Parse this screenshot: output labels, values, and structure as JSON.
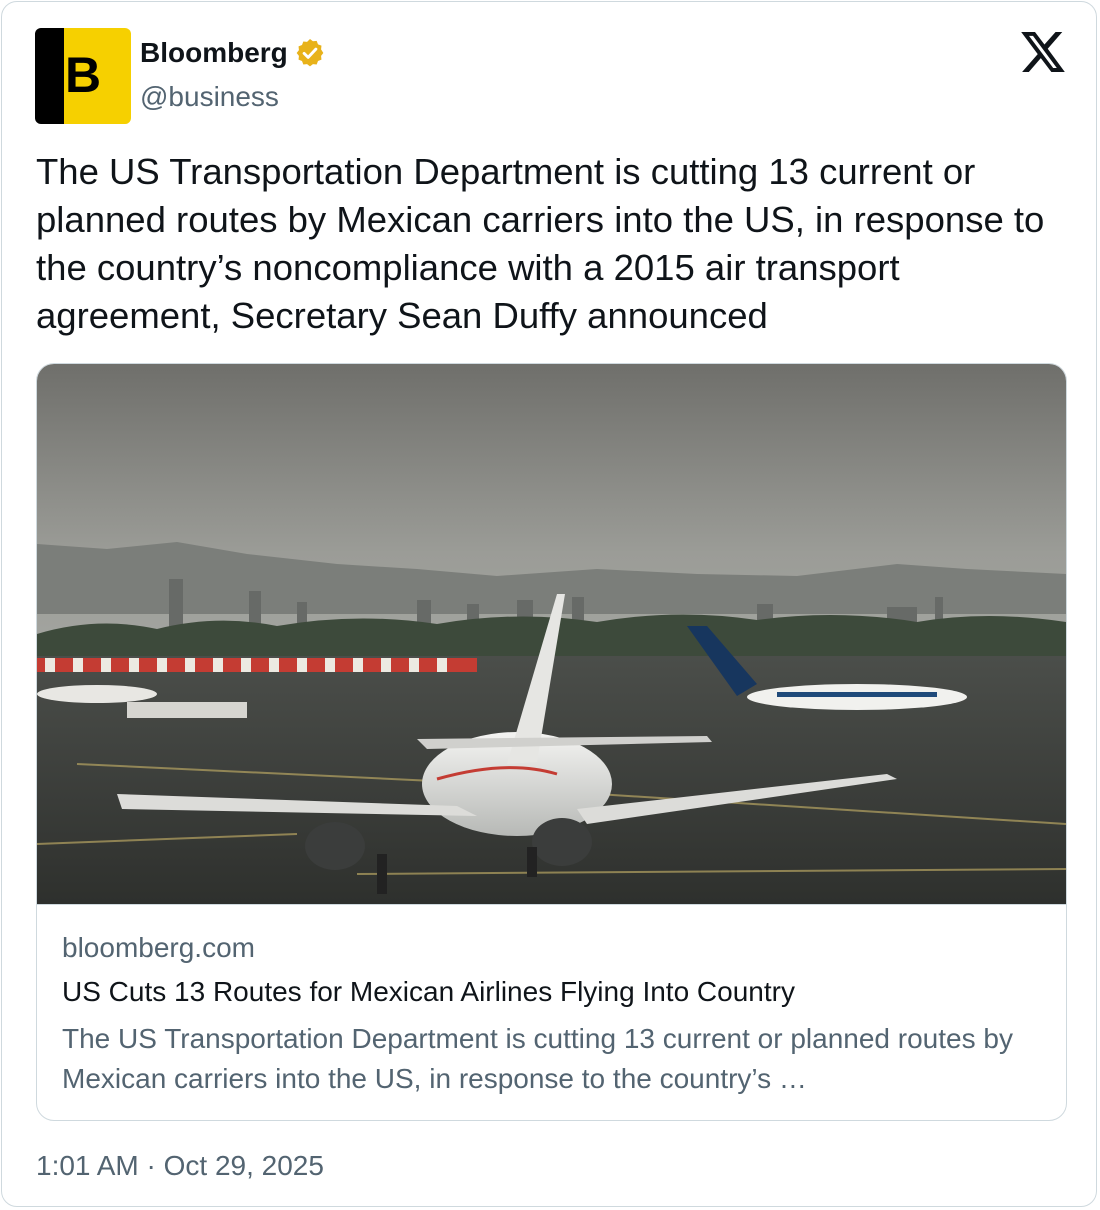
{
  "author": {
    "display_name": "Bloomberg",
    "handle": "@business",
    "avatar_letter": "B",
    "verified": true,
    "avatar_icon": "bloomberg-logo",
    "verified_icon": "verified-badge-icon"
  },
  "platform": {
    "logo_icon": "x-logo-icon"
  },
  "tweet": {
    "text": "The US Transportation Department is cutting 13 current or planned routes by Mexican carriers into the US, in response to the country’s noncompliance with a 2015 air transport agreement, Secretary Sean Duffy announced"
  },
  "link_card": {
    "image_desc": "aircraft-photo",
    "domain": "bloomberg.com",
    "title": "US Cuts 13 Routes for Mexican Airlines Flying Into Country",
    "description": "The US Transportation Department is cutting 13 current or planned routes by Mexican carriers into the US, in response to the country’s …"
  },
  "timestamp": "1:01 AM · Oct 29, 2025",
  "colors": {
    "text_primary": "#0f1419",
    "text_secondary": "#536471",
    "border": "#cfd9de",
    "bloomberg_yellow": "#f6d000",
    "verified_gold": "#e8b21a"
  }
}
